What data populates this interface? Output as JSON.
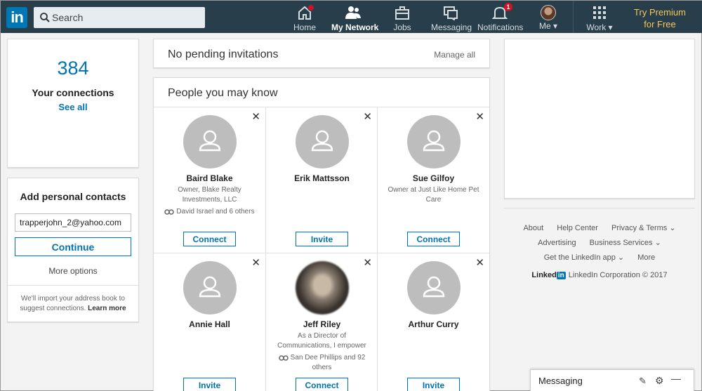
{
  "header": {
    "logo": "in",
    "search_placeholder": "Search",
    "nav": [
      {
        "label": "Home",
        "icon": "home-icon",
        "badge": ""
      },
      {
        "label": "My Network",
        "icon": "people-icon",
        "badge": ""
      },
      {
        "label": "Jobs",
        "icon": "briefcase-icon",
        "badge": ""
      },
      {
        "label": "Messaging",
        "icon": "chat-icon",
        "badge": ""
      },
      {
        "label": "Notifications",
        "icon": "bell-icon",
        "badge": "1"
      },
      {
        "label": "Me",
        "icon": "avatar"
      },
      {
        "label": "Work",
        "icon": "grid-icon"
      }
    ],
    "premium_line1": "Try Premium",
    "premium_line2": "for Free",
    "colors": {
      "bar": "#283e4a",
      "brand": "#0077b5",
      "premium": "#f5c75d"
    }
  },
  "left": {
    "connections_count": "384",
    "connections_label": "Your connections",
    "see_all": "See all",
    "contacts_title": "Add personal contacts",
    "email_value": "trapperjohn_2@yahoo.com",
    "continue_label": "Continue",
    "more_options": "More options",
    "import_note": "We'll import your address book to suggest connections.",
    "learn_more": "Learn more"
  },
  "main": {
    "pending_title": "No pending invitations",
    "manage_all": "Manage all",
    "pymk_title": "People you may know",
    "people": [
      {
        "name": "Baird Blake",
        "headline": "Owner, Blake Realty Investments, LLC",
        "mutual": "David Israel and 6 others",
        "action": "Connect"
      },
      {
        "name": "Erik Mattsson",
        "headline": "",
        "mutual": "",
        "action": "Invite"
      },
      {
        "name": "Sue Gilfoy",
        "headline": "Owner at Just Like Home Pet Care",
        "mutual": "",
        "action": "Connect"
      },
      {
        "name": "Annie Hall",
        "headline": "",
        "mutual": "",
        "action": "Invite"
      },
      {
        "name": "Jeff Riley",
        "headline": "As a Director of Communications, I empower",
        "mutual": "San Dee Phillips and 92 others",
        "action": "Connect"
      },
      {
        "name": "Arthur Curry",
        "headline": "",
        "mutual": "",
        "action": "Invite"
      }
    ],
    "close_glyph": "✕"
  },
  "right": {
    "footer_row1": [
      "About",
      "Help Center",
      "Privacy & Terms ⌄"
    ],
    "footer_row2": [
      "Advertising",
      "Business Services ⌄"
    ],
    "footer_row3": [
      "Get the LinkedIn app ⌄",
      "More"
    ],
    "brand_word": "Linked",
    "brand_in": "in",
    "copyright": "LinkedIn Corporation © 2017"
  },
  "messaging": {
    "label": "Messaging"
  }
}
